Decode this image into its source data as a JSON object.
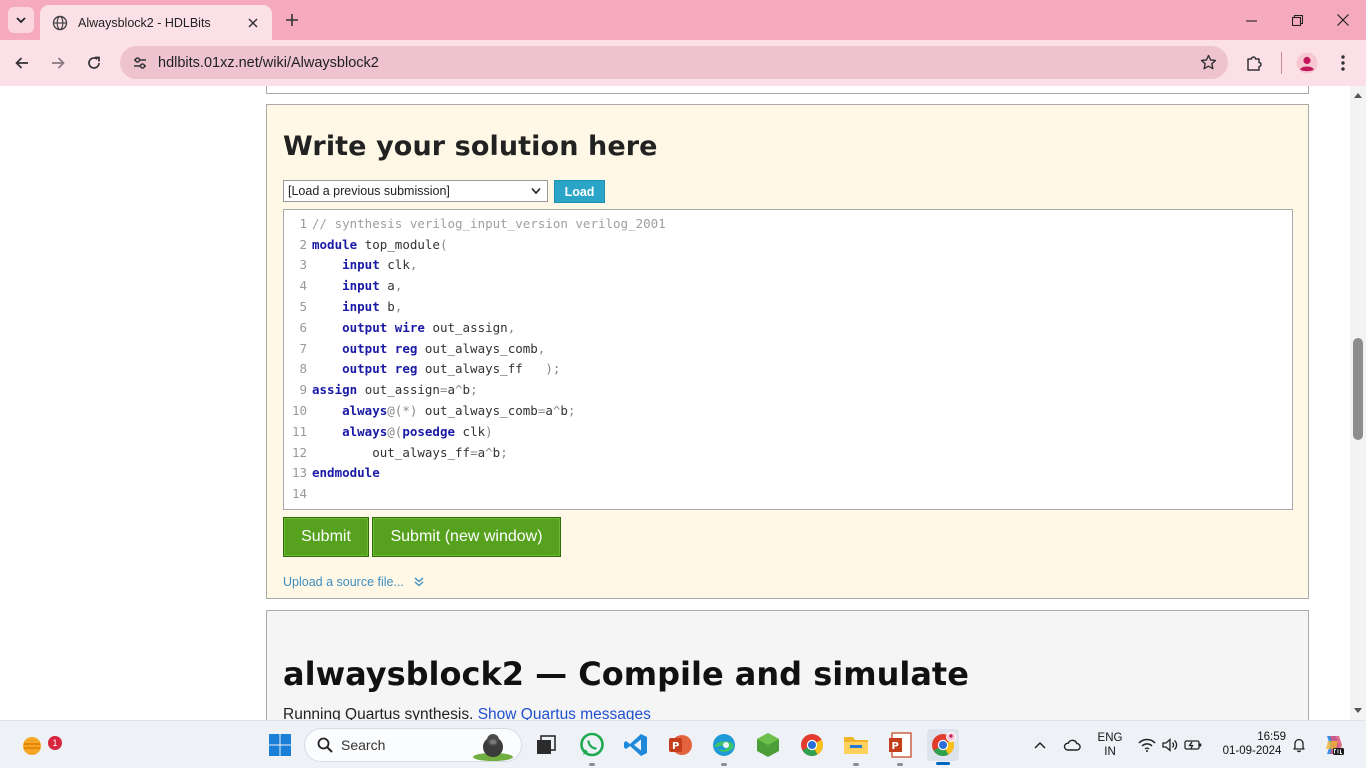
{
  "browser": {
    "tab_title": "Alwaysblock2 - HDLBits",
    "url": "hdlbits.01xz.net/wiki/Alwaysblock2"
  },
  "solution": {
    "heading": "Write your solution here",
    "select_value": "[Load a previous submission]",
    "load_label": "Load",
    "code_lines": [
      {
        "n": "1",
        "t": "// synthesis verilog_input_version verilog_2001"
      },
      {
        "n": "2",
        "t": "module top_module("
      },
      {
        "n": "3",
        "t": "    input clk,"
      },
      {
        "n": "4",
        "t": "    input a,"
      },
      {
        "n": "5",
        "t": "    input b,"
      },
      {
        "n": "6",
        "t": "    output wire out_assign,"
      },
      {
        "n": "7",
        "t": "    output reg out_always_comb,"
      },
      {
        "n": "8",
        "t": "    output reg out_always_ff   );"
      },
      {
        "n": "9",
        "t": "assign out_assign=a^b;"
      },
      {
        "n": "10",
        "t": "    always@(*) out_always_comb=a^b;"
      },
      {
        "n": "11",
        "t": "    always@(posedge clk)"
      },
      {
        "n": "12",
        "t": "        out_always_ff=a^b;"
      },
      {
        "n": "13",
        "t": "endmodule"
      },
      {
        "n": "14",
        "t": ""
      }
    ],
    "submit_label": "Submit",
    "submit_new_label": "Submit (new window)",
    "upload_label": "Upload a source file..."
  },
  "compile": {
    "heading": "alwaysblock2 — Compile and simulate",
    "status_text": "Running Quartus synthesis.",
    "status_link": "Show Quartus messages"
  },
  "taskbar": {
    "search_label": "Search",
    "widget_badge": "1",
    "lang_line1": "ENG",
    "lang_line2": "IN",
    "time": "16:59",
    "date": "01-09-2024"
  },
  "icons": {
    "tab_list": "chevron-down-icon",
    "favicon": "globe-icon",
    "close": "close-icon",
    "new_tab": "plus-icon",
    "back": "arrow-left-icon",
    "forward": "arrow-right-icon",
    "reload": "reload-icon",
    "site_info": "tune-icon",
    "bookmark": "star-icon",
    "extensions": "puzzle-icon",
    "profile": "avatar-icon",
    "menu": "kebab-menu-icon"
  },
  "colors": {
    "tab_strip": "#f5aabe",
    "toolbar": "#fbe0e7",
    "solution_bg": "#fff8e6",
    "keyword": "#1a1aa6",
    "load_button": "#2aa5c8",
    "submit_button": "#56a11e"
  }
}
